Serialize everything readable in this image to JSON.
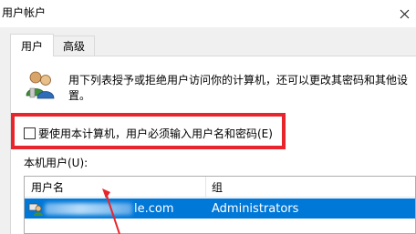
{
  "window": {
    "title": "用户帐户",
    "close_glyph": "✕"
  },
  "tabs": [
    {
      "label": "用户",
      "selected": true
    },
    {
      "label": "高级",
      "selected": false
    }
  ],
  "description": "用下列表授予或拒绝用户访问你的计算机，还可以更改其密码和其他设置。",
  "require_login_checkbox": {
    "label": "要使用本计算机，用户必须输入用户名和密码(E)",
    "checked": false
  },
  "user_list": {
    "label": "本机用户(U):",
    "columns": [
      "用户名",
      "组"
    ],
    "rows": [
      {
        "name_visible": "le.com",
        "group": "Administrators",
        "selected": true
      }
    ]
  },
  "annotation": {
    "highlight_color": "#e8252c"
  },
  "colors": {
    "selection": "#0078d7",
    "panel_bg": "#f0f0f0"
  }
}
